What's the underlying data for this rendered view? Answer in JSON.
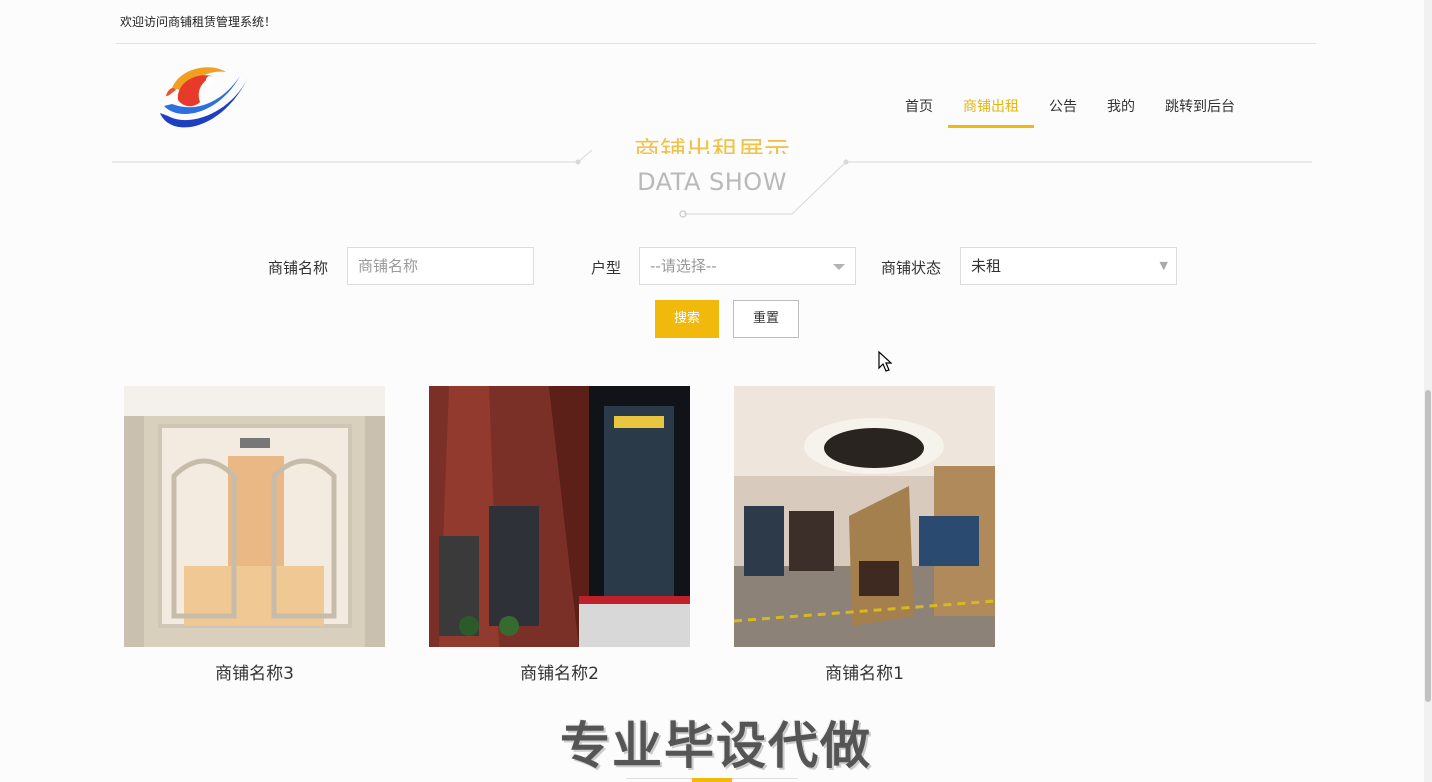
{
  "header": {
    "welcome": "欢迎访问商铺租赁管理系统！"
  },
  "nav": {
    "items": [
      {
        "label": "首页"
      },
      {
        "label": "商铺出租"
      },
      {
        "label": "公告"
      },
      {
        "label": "我的"
      },
      {
        "label": "跳转到后台"
      }
    ],
    "active_index": 1
  },
  "section": {
    "title_cn": "商铺出租展示",
    "title_en": "DATA SHOW"
  },
  "search": {
    "name_label": "商铺名称",
    "name_placeholder": "商铺名称",
    "type_label": "户型",
    "type_value": "--请选择--",
    "status_label": "商铺状态",
    "status_value": "未租",
    "search_button": "搜索",
    "reset_button": "重置"
  },
  "listings": [
    {
      "name": "商铺名称3"
    },
    {
      "name": "商铺名称2"
    },
    {
      "name": "商铺名称1"
    }
  ],
  "watermark": "专业毕设代做",
  "colors": {
    "accent": "#f0b90b",
    "accent_text": "#e8b50c"
  }
}
